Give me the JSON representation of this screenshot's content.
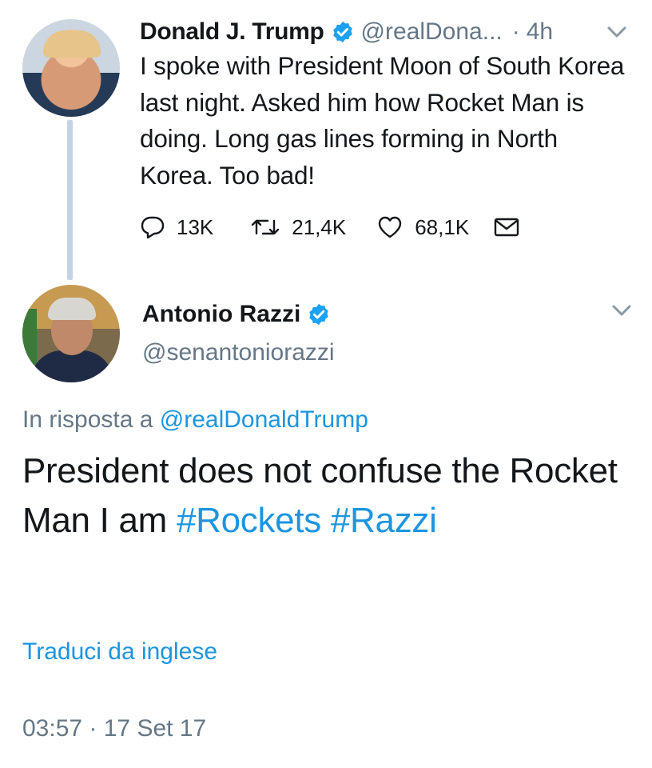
{
  "tweet1": {
    "name": "Donald J. Trump",
    "handle": "@realDona...",
    "separator": "·",
    "time": "4h",
    "text": "I spoke with President Moon of South Korea last night. Asked him how Rocket Man is doing. Long gas lines forming in North Korea. Too bad!",
    "replies": "13K",
    "retweets": "21,4K",
    "likes": "68,1K"
  },
  "tweet2": {
    "name": "Antonio Razzi",
    "handle": "@senantoniorazzi",
    "reply_prefix": "In risposta a",
    "reply_mention": "@realDonaldTrump",
    "text_plain": "President does not confuse the Rocket Man I am",
    "hashtag1": "#Rockets",
    "hashtag2": "#Razzi",
    "translate": "Traduci da inglese",
    "timestamp": "03:57 · 17 Set 17"
  },
  "colors": {
    "link": "#1b95e0",
    "secondary": "#657786",
    "verified": "#1da1f2",
    "thread_line": "#c3d3e6"
  },
  "icons": [
    "verified-badge-icon",
    "chevron-down-icon",
    "reply-icon",
    "retweet-icon",
    "like-icon",
    "direct-message-icon"
  ]
}
